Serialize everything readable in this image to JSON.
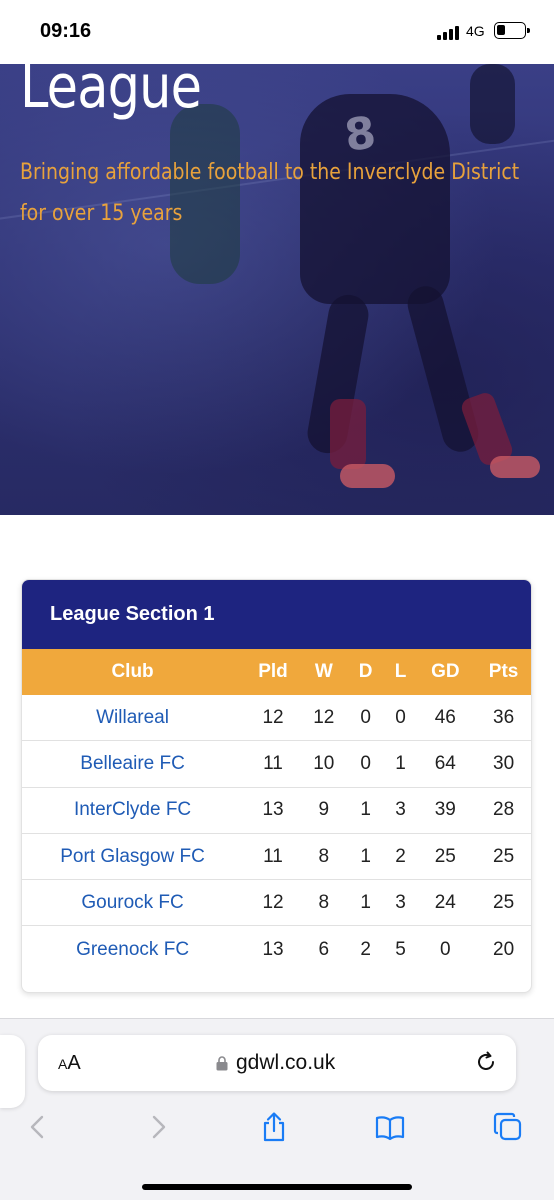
{
  "status_bar": {
    "time": "09:16",
    "network": "4G",
    "icons": [
      "signal-icon",
      "battery-icon"
    ]
  },
  "hero": {
    "title": "League",
    "subtitle_line1": "Bringing affordable football to the Inverclyde District",
    "subtitle_line2": "for over 15 years",
    "shirt_number": "8",
    "colors": {
      "overlay": "#2b2f6e",
      "subtitle": "#e8a23c"
    }
  },
  "league": {
    "section_title": "League Section 1",
    "columns": [
      "Club",
      "Pld",
      "W",
      "D",
      "L",
      "GD",
      "Pts"
    ],
    "rows": [
      {
        "club": "Willareal",
        "pld": "12",
        "w": "12",
        "d": "0",
        "l": "0",
        "gd": "46",
        "pts": "36"
      },
      {
        "club": "Belleaire FC",
        "pld": "11",
        "w": "10",
        "d": "0",
        "l": "1",
        "gd": "64",
        "pts": "30"
      },
      {
        "club": "InterClyde FC",
        "pld": "13",
        "w": "9",
        "d": "1",
        "l": "3",
        "gd": "39",
        "pts": "28"
      },
      {
        "club": "Port Glasgow FC",
        "pld": "11",
        "w": "8",
        "d": "1",
        "l": "2",
        "gd": "25",
        "pts": "25"
      },
      {
        "club": "Gourock FC",
        "pld": "12",
        "w": "8",
        "d": "1",
        "l": "3",
        "gd": "24",
        "pts": "25"
      },
      {
        "club": "Greenock FC",
        "pld": "13",
        "w": "6",
        "d": "2",
        "l": "5",
        "gd": "0",
        "pts": "20"
      }
    ],
    "colors": {
      "header": "#1e2480",
      "columns": "#f0a83c",
      "club_link": "#1f5bb5"
    }
  },
  "browser": {
    "aa_label_small": "A",
    "aa_label_large": "A",
    "url": "gdwl.co.uk",
    "icons": [
      "lock-icon",
      "reload-icon",
      "back-icon",
      "forward-icon",
      "share-icon",
      "bookmarks-icon",
      "tabs-icon"
    ],
    "accent": "#1a7cf5"
  }
}
